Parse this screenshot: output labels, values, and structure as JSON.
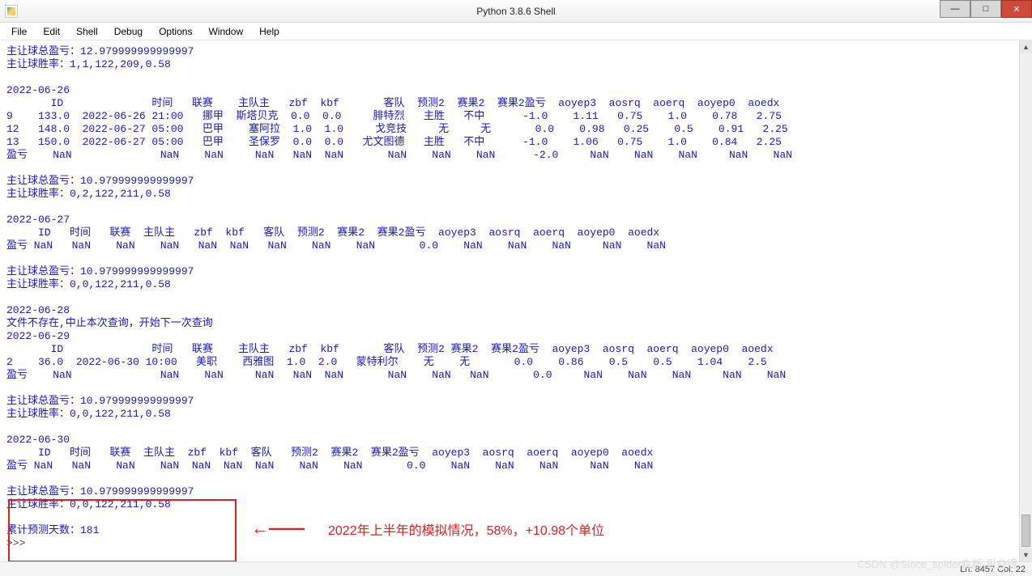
{
  "window": {
    "title": "Python 3.8.6 Shell",
    "min_label": "—",
    "max_label": "□",
    "close_label": "✕"
  },
  "menu": {
    "file": "File",
    "edit": "Edit",
    "shell": "Shell",
    "debug": "Debug",
    "options": "Options",
    "window": "Window",
    "help": "Help"
  },
  "shell_output": "主让球总盈亏：12.979999999999997\n主让球胜率：1,1,122,209,0.58\n\n2022-06-26\n       ID              时间   联赛    主队主   zbf  kbf       客队  预测2  赛果2  赛果2盈亏  aoyep3  aosrq  aoerq  aoyep0  aoedx\n9    133.0  2022-06-26 21:00   挪甲  斯塔贝克  0.0  0.0     腓特烈   主胜   不中      -1.0    1.11   0.75    1.0    0.78   2.75\n12   148.0  2022-06-27 05:00   巴甲    塞阿拉  1.0  1.0     戈竞技     无     无       0.0    0.98   0.25    0.5    0.91   2.25\n13   150.0  2022-06-27 05:00   巴甲    圣保罗  0.0  0.0   尤文图德   主胜   不中      -1.0    1.06   0.75    1.0    0.84   2.25\n盈亏    NaN              NaN    NaN     NaN   NaN  NaN       NaN    NaN    NaN      -2.0     NaN    NaN    NaN     NaN    NaN\n\n主让球总盈亏：10.979999999999997\n主让球胜率：0,2,122,211,0.58\n\n2022-06-27\n     ID   时间   联赛  主队主   zbf  kbf   客队  预测2  赛果2  赛果2盈亏  aoyep3  aosrq  aoerq  aoyep0  aoedx\n盈亏 NaN   NaN    NaN    NaN   NaN  NaN   NaN    NaN    NaN       0.0    NaN    NaN    NaN     NaN    NaN\n\n主让球总盈亏：10.979999999999997\n主让球胜率：0,0,122,211,0.58\n\n2022-06-28\n文件不存在,中止本次查询，开始下一次查询\n2022-06-29\n       ID              时间   联赛    主队主   zbf  kbf       客队  预测2 赛果2  赛果2盈亏  aoyep3  aosrq  aoerq  aoyep0  aoedx\n2    36.0  2022-06-30 10:00   美职    西雅图  1.0  2.0   蒙特利尔    无    无       0.0    0.86    0.5    0.5    1.04    2.5\n盈亏    NaN              NaN    NaN     NaN   NaN  NaN       NaN    NaN   NaN       0.0     NaN    NaN    NaN     NaN    NaN\n\n主让球总盈亏：10.979999999999997\n主让球胜率：0,0,122,211,0.58\n\n2022-06-30\n     ID   时间   联赛  主队主  zbf  kbf  客队   预测2  赛果2  赛果2盈亏  aoyep3  aosrq  aoerq  aoyep0  aoedx\n盈亏 NaN   NaN    NaN    NaN  NaN  NaN  NaN    NaN    NaN       0.0    NaN    NaN    NaN     NaN    NaN\n\n主让球总盈亏：10.979999999999997\n主让球胜率：0,0,122,211,0.58\n\n累计预测天数：181",
  "prompt_text": ">>> ",
  "annotation": {
    "text": "2022年上半年的模拟情况，58%，+10.98个单位",
    "arrow": "←——"
  },
  "status": {
    "text": "Ln: 8457 Col: 22"
  },
  "watermark": "CSDN @Since_spider森斯·思白得"
}
